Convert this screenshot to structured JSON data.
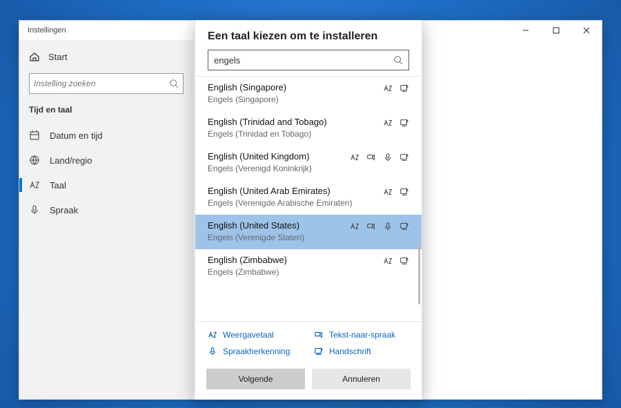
{
  "window": {
    "title": "Instellingen",
    "min": "–",
    "max": "□",
    "close": "×"
  },
  "sidebar": {
    "home": "Start",
    "search_placeholder": "Instelling zoeken",
    "section": "Tijd en taal",
    "items": [
      {
        "label": "Datum en tijd",
        "icon": "calendar",
        "active": false
      },
      {
        "label": "Land/regio",
        "icon": "globe",
        "active": false
      },
      {
        "label": "Taal",
        "icon": "az",
        "active": true
      },
      {
        "label": "Spraak",
        "icon": "mic",
        "active": false
      }
    ]
  },
  "dialog": {
    "title": "Een taal kiezen om te installeren",
    "search_value": "engels",
    "languages": [
      {
        "name": "English (Singapore)",
        "sub": "Engels (Singapore)",
        "features": [
          "az",
          "hand"
        ],
        "selected": false
      },
      {
        "name": "English (Trinidad and Tobago)",
        "sub": "Engels (Trinidad en Tobago)",
        "features": [
          "az",
          "hand"
        ],
        "selected": false
      },
      {
        "name": "English (United Kingdom)",
        "sub": "Engels (Verenigd Koninkrijk)",
        "features": [
          "az",
          "tts",
          "mic",
          "hand"
        ],
        "selected": false
      },
      {
        "name": "English (United Arab Emirates)",
        "sub": "Engels (Verenigde Arabische Emiraten)",
        "features": [
          "az",
          "hand"
        ],
        "selected": false
      },
      {
        "name": "English (United States)",
        "sub": "Engels (Verenigde Staten)",
        "features": [
          "az",
          "tts",
          "mic",
          "hand"
        ],
        "selected": true
      },
      {
        "name": "English (Zimbabwe)",
        "sub": "Engels (Zimbabwe)",
        "features": [
          "az",
          "hand"
        ],
        "selected": false
      }
    ],
    "legend": {
      "display": "Weergavetaal",
      "tts": "Tekst-naar-spraak",
      "speech": "Spraakherkenning",
      "hand": "Handschrift"
    },
    "next": "Volgende",
    "cancel": "Annuleren"
  }
}
